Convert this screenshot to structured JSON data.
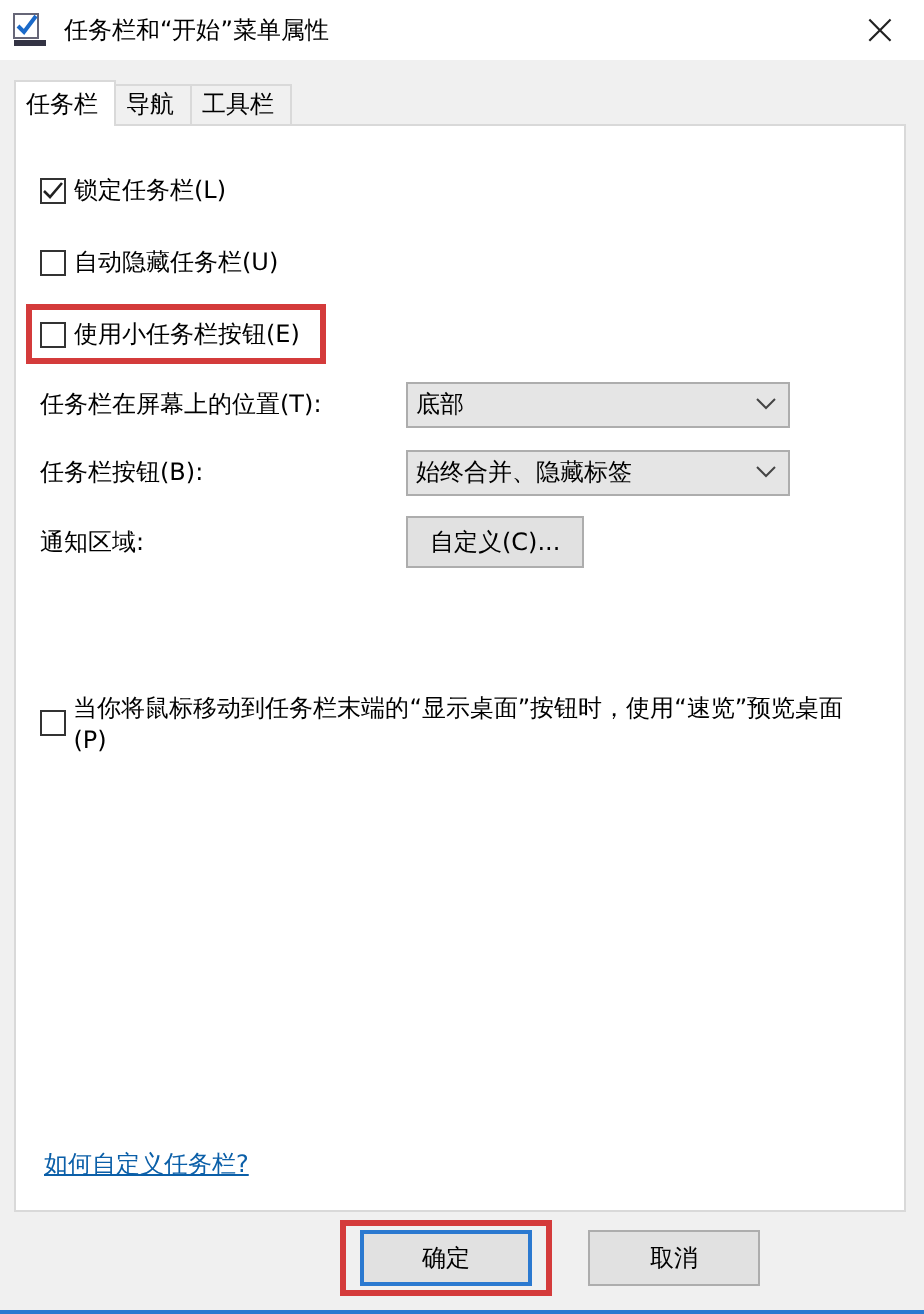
{
  "window": {
    "title": "任务栏和“开始”菜单属性",
    "close": "×"
  },
  "tabs": [
    {
      "label": "任务栏",
      "selected": true
    },
    {
      "label": "导航",
      "selected": false
    },
    {
      "label": "工具栏",
      "selected": false
    }
  ],
  "checkboxes": [
    {
      "label": "锁定任务栏(L)",
      "checked": true,
      "highlighted": false
    },
    {
      "label": "自动隐藏任务栏(U)",
      "checked": false,
      "highlighted": false
    },
    {
      "label": "使用小任务栏按钮(E)",
      "checked": false,
      "highlighted": true
    }
  ],
  "settings": [
    {
      "kind": "dropdown",
      "label": "任务栏在屏幕上的位置(T):",
      "value": "底部"
    },
    {
      "kind": "dropdown",
      "label": "任务栏按钮(B):",
      "value": "始终合并、隐藏标签"
    },
    {
      "kind": "button",
      "label": "通知区域:",
      "value": "自定义(C)..."
    }
  ],
  "peek": {
    "label": "当你将鼠标移动到任务栏末端的“显示桌面”按钮时，使用“速览”预览桌面(P)",
    "checked": false
  },
  "help_link": "如何自定义任务栏?",
  "buttons": [
    {
      "label": "确定",
      "highlighted": true
    },
    {
      "label": "取消",
      "highlighted": false
    }
  ]
}
